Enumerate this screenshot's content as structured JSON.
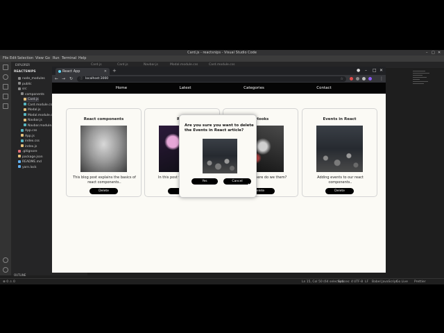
{
  "vscode": {
    "title": "Card.js - reactsnips - Visual Studio Code",
    "menu": [
      "File",
      "Edit",
      "Selection",
      "View",
      "Go",
      "Run",
      "Terminal",
      "Help"
    ],
    "tabs": [
      "Card.js",
      "Card.js",
      "Navbar.js",
      "Modal.module.css",
      "Card.module.css"
    ],
    "explorer_header": "EXPLORER",
    "project": "REACTSNIPS",
    "tree": [
      {
        "label": "node_modules",
        "color": "#8a8a8a"
      },
      {
        "label": "public",
        "color": "#8a8a8a"
      },
      {
        "label": "src",
        "color": "#8a8a8a"
      },
      {
        "label": "components",
        "color": "#8a8a8a"
      },
      {
        "label": "Card.js",
        "color": "#e5c07b"
      },
      {
        "label": "Card.module.css",
        "color": "#56b6c2"
      },
      {
        "label": "Modal.js",
        "color": "#e5c07b"
      },
      {
        "label": "Modal.module.css",
        "color": "#56b6c2"
      },
      {
        "label": "Navbar.js",
        "color": "#e5c07b"
      },
      {
        "label": "Navbar.module.css",
        "color": "#56b6c2"
      },
      {
        "label": "App.css",
        "color": "#56b6c2"
      },
      {
        "label": "App.js",
        "color": "#e5c07b"
      },
      {
        "label": "index.css",
        "color": "#56b6c2"
      },
      {
        "label": "index.js",
        "color": "#e5c07b"
      },
      {
        "label": ".gitignore",
        "color": "#e06c75"
      },
      {
        "label": "package.json",
        "color": "#e5c07b"
      },
      {
        "label": "README.md",
        "color": "#61afef"
      },
      {
        "label": "yarn.lock",
        "color": "#61afef"
      }
    ],
    "outline": "OUTLINE",
    "timeline": "TIMELINE",
    "status_left": "⊗ 0 ⚠ 0",
    "status_mid": "Ln 15, Col 50 (64 selected)",
    "status_items": [
      "Spaces: 4",
      "UTF-8",
      "LF",
      "Babel JavaScript",
      "Go Live",
      "Prettier"
    ]
  },
  "browser": {
    "tab_title": "React App",
    "url": "localhost:3000"
  },
  "app": {
    "nav": [
      "Home",
      "Latest",
      "Categories",
      "Contact"
    ],
    "cards": [
      {
        "title": "React components",
        "desc": "This blog post explains the basics of react components..",
        "button": "Delete",
        "image": "fog-forest"
      },
      {
        "title": "Reac",
        "desc": "In this post we will data thro",
        "button": "De",
        "image": "flower"
      },
      {
        "title": "t Hooks",
        "desc": "ooks and where do we them?",
        "button": "elete",
        "image": "hand-bottle"
      },
      {
        "title": "Events in React",
        "desc": "Adding events to our react components..",
        "button": "Delete",
        "image": "stones"
      }
    ],
    "modal": {
      "question": "Are you sure you want to delete the Events in React article?",
      "yes": "Yes",
      "cancel": "Cancel",
      "image": "stones"
    }
  }
}
